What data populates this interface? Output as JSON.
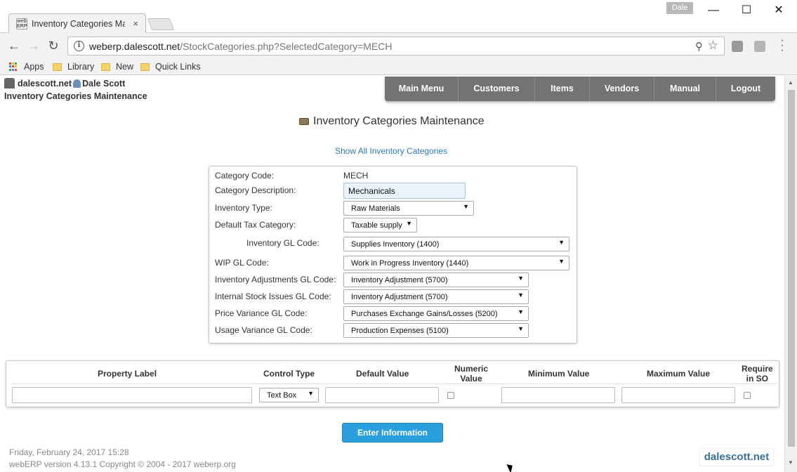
{
  "browser": {
    "tab_title": "Inventory Categories Ma",
    "tab_close": "×",
    "favicon_text": "web ERP",
    "profile_name": "Dale",
    "minimize": "—",
    "maximize": "☐",
    "close": "✕",
    "url_host": "weberp.dalescott.net",
    "url_path": "/StockCategories.php?SelectedCategory=MECH",
    "back": "←",
    "forward": "→",
    "reload": "↻",
    "bookmarks": [
      "Apps",
      "Library",
      "New",
      "Quick Links"
    ]
  },
  "header": {
    "company": "dalescott.net",
    "user": "Dale Scott",
    "page_title": "Inventory Categories Maintenance"
  },
  "nav": {
    "items": [
      {
        "label": "Main Menu"
      },
      {
        "label": "Customers"
      },
      {
        "label": "Items"
      },
      {
        "label": "Vendors"
      },
      {
        "label": "Manual"
      },
      {
        "label": "Logout"
      }
    ]
  },
  "main": {
    "heading": "Inventory Categories Maintenance",
    "show_all_link": "Show All Inventory Categories"
  },
  "form": {
    "category_code_label": "Category Code:",
    "category_code_value": "MECH",
    "category_description_label": "Category Description:",
    "category_description_value": "Mechanicals",
    "inventory_type_label": "Inventory Type:",
    "inventory_type_value": "Raw Materials",
    "tax_category_label": "Default Tax Category:",
    "tax_category_value": "Taxable supply",
    "inventory_gl_label": "Inventory GL Code:",
    "inventory_gl_value": "Supplies Inventory (1400)",
    "wip_gl_label": "WIP GL Code:",
    "wip_gl_value": "Work in Progress Inventory (1440)",
    "adjustments_gl_label": "Inventory Adjustments GL Code:",
    "adjustments_gl_value": "Inventory Adjustment (5700)",
    "issues_gl_label": "Internal Stock Issues GL Code:",
    "issues_gl_value": "Inventory Adjustment (5700)",
    "price_variance_gl_label": "Price Variance GL Code:",
    "price_variance_gl_value": "Purchases Exchange Gains/Losses (5200)",
    "usage_variance_gl_label": "Usage Variance GL Code:",
    "usage_variance_gl_value": "Production Expenses (5100)"
  },
  "properties": {
    "headers": {
      "property_label": "Property Label",
      "control_type": "Control Type",
      "default_value": "Default Value",
      "numeric_value_1": "Numeric",
      "numeric_value_2": "Value",
      "minimum_value": "Minimum Value",
      "maximum_value": "Maximum Value",
      "require_so_1": "Require",
      "require_so_2": "in SO"
    },
    "row": {
      "property_label": "",
      "control_type": "Text Box",
      "default_value": "",
      "numeric": false,
      "minimum_value": "",
      "maximum_value": "",
      "require_in_so": false
    }
  },
  "submit_label": "Enter Information",
  "footer": {
    "date": "Friday, February 24, 2017 15:28",
    "version": "webERP version 4.13.1 Copyright © 2004 - 2017 weberp.org",
    "brand": "dalescott.net"
  },
  "colors": {
    "nav_bg": "#737373",
    "button_bg": "#2b9fde",
    "link": "#2a7ab8"
  }
}
